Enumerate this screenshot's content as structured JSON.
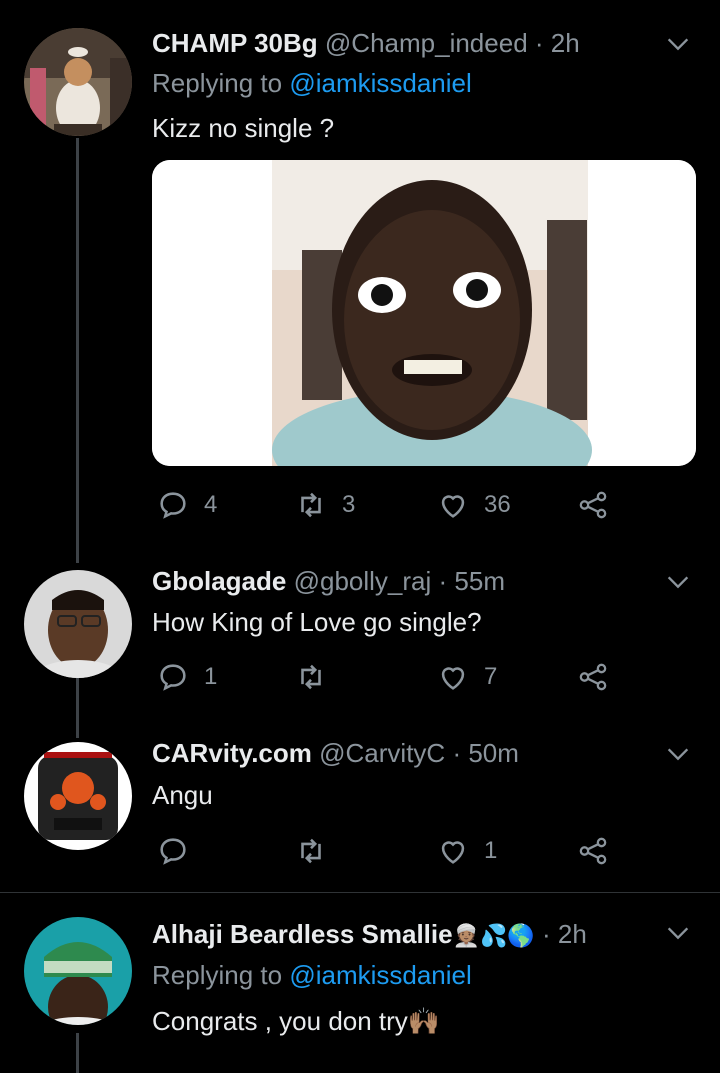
{
  "tweets": [
    {
      "name": "CHAMP 30Bg",
      "handle": "@Champ_indeed",
      "time": "2h",
      "replying_prefix": "Replying to ",
      "replying_to": "@iamkissdaniel",
      "text": "Kizz no single ?",
      "replies": "4",
      "retweets": "3",
      "likes": "36"
    },
    {
      "name": "Gbolagade",
      "handle": "@gbolly_raj",
      "time": "55m",
      "text": "How King of Love go single?",
      "replies": "1",
      "retweets": "",
      "likes": "7"
    },
    {
      "name": "CARvity.com",
      "handle": "@CarvityC",
      "time": "50m",
      "text": "Angu",
      "replies": "",
      "retweets": "",
      "likes": "1"
    },
    {
      "name": "Alhaji Beardless Smallie",
      "name_emojis": "👳🏽💦🌎",
      "handle": "",
      "time": "2h",
      "replying_prefix": "Replying to ",
      "replying_to": "@iamkissdaniel",
      "text": "Congrats , you don try🙌🏽"
    }
  ],
  "separator": "·",
  "icons": {
    "reply": "reply-icon",
    "retweet": "retweet-icon",
    "like": "heart-icon",
    "share": "share-icon",
    "more": "chevron-down-icon"
  },
  "colors": {
    "background": "#000000",
    "link": "#1d9bf0",
    "muted": "#8b949c"
  }
}
